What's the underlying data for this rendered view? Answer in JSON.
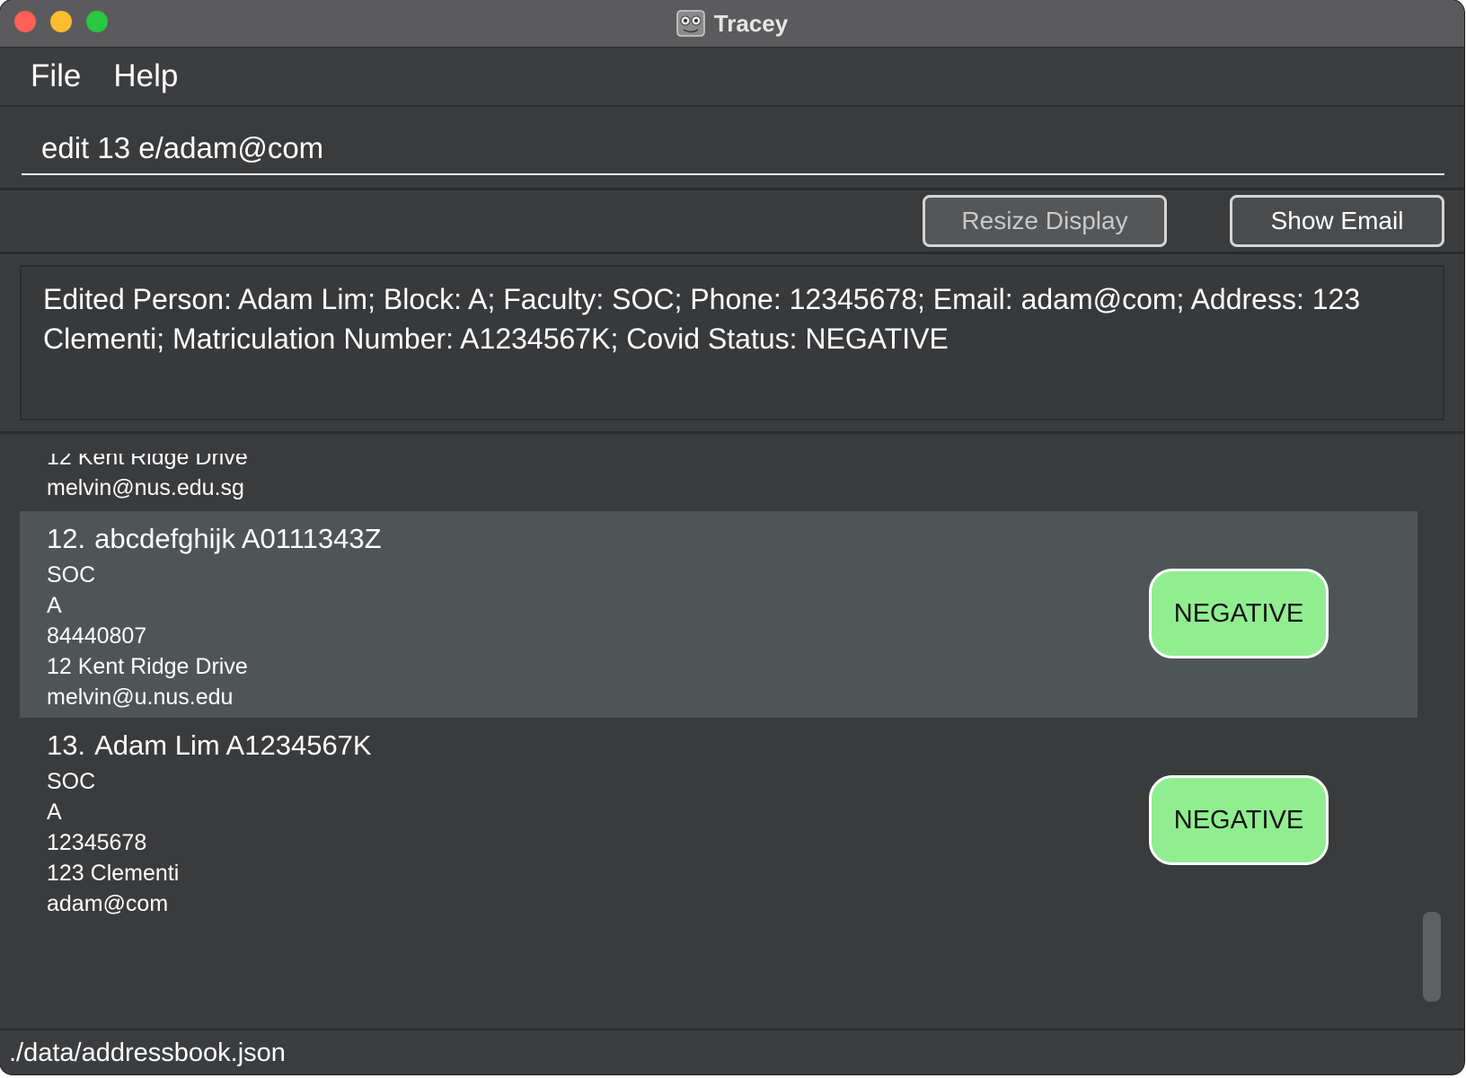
{
  "window": {
    "title": "Tracey"
  },
  "menu": {
    "items": [
      "File",
      "Help"
    ]
  },
  "command": {
    "value": "edit 13 e/adam@com"
  },
  "buttons": {
    "resize_display": "Resize Display",
    "show_email": "Show Email"
  },
  "result": {
    "text": "Edited Person: Adam Lim; Block: A; Faculty: SOC; Phone: 12345678; Email: adam@com; Address: 123 Clementi; Matriculation Number: A1234567K; Covid Status: NEGATIVE"
  },
  "persons": {
    "partial": {
      "address": "12 Kent Ridge Drive",
      "email": "melvin@nus.edu.sg"
    },
    "list": [
      {
        "index": "12.",
        "name": "abcdefghijk A0111343Z",
        "faculty": "SOC",
        "block": "A",
        "phone": "84440807",
        "address": "12 Kent Ridge Drive",
        "email": "melvin@u.nus.edu",
        "status": "NEGATIVE",
        "selected": true
      },
      {
        "index": "13.",
        "name": "Adam Lim A1234567K",
        "faculty": "SOC",
        "block": "A",
        "phone": "12345678",
        "address": "123 Clementi",
        "email": "adam@com",
        "status": "NEGATIVE",
        "selected": false
      }
    ]
  },
  "status_bar": {
    "path": "./data/addressbook.json"
  },
  "colors": {
    "background": "#3a3b3d",
    "selected_card": "#4f5457",
    "status_negative": "#90ee90",
    "title_bar": "#5b5b5d"
  }
}
